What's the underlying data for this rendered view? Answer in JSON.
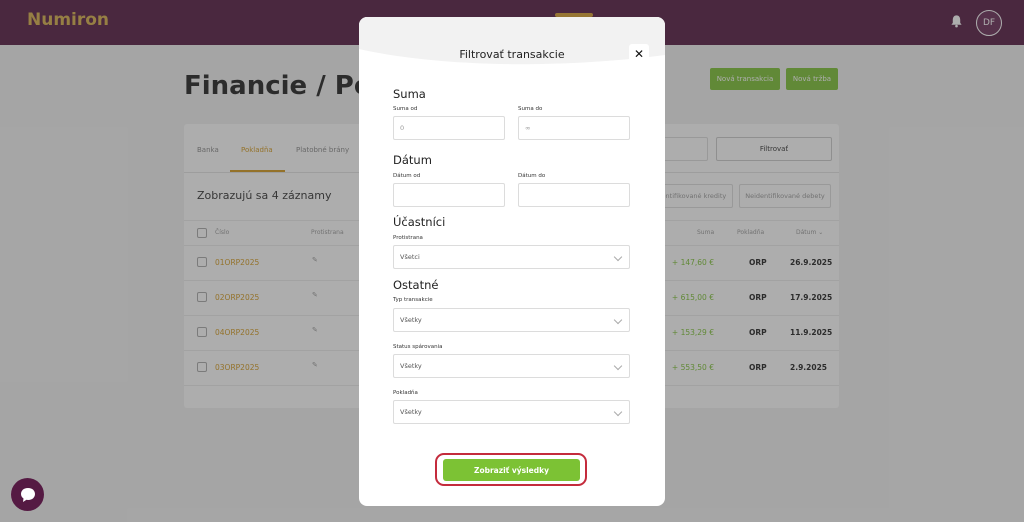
{
  "app": {
    "logo": "Numiron",
    "user_initials": "DF"
  },
  "page": {
    "title": "Financie / Pok",
    "new_transaction_label": "Nová transakcia",
    "new_other_label": "Nová tržba"
  },
  "tabs": [
    {
      "label": "Banka",
      "active": false
    },
    {
      "label": "Pokladňa",
      "active": true
    },
    {
      "label": "Platobné brány",
      "active": false
    }
  ],
  "toolbar": {
    "filter_label": "Filtrovať",
    "count_text": "Zobrazujú sa 4 záznamy",
    "chip_credits": "Neidentifikované kredity",
    "chip_debits": "Neidentifikované debety"
  },
  "table": {
    "headers": {
      "number": "Číslo",
      "counterparty": "Protistrana",
      "amount": "Suma",
      "cashbox": "Pokladňa",
      "date": "Dátum"
    },
    "rows": [
      {
        "number": "01ORP2025",
        "amount": "+ 147,60 €",
        "cashbox": "ORP",
        "date": "26.9.2025"
      },
      {
        "number": "02ORP2025",
        "amount": "+ 615,00 €",
        "cashbox": "ORP",
        "date": "17.9.2025"
      },
      {
        "number": "04ORP2025",
        "amount": "+ 153,29 €",
        "cashbox": "ORP",
        "date": "11.9.2025"
      },
      {
        "number": "03ORP2025",
        "amount": "+ 553,50 €",
        "cashbox": "ORP",
        "date": "2.9.2025"
      }
    ]
  },
  "modal": {
    "title": "Filtrovať transakcie",
    "close_glyph": "✕",
    "sections": {
      "amount": {
        "title": "Suma",
        "from_label": "Suma od",
        "from_value": "0",
        "to_label": "Suma do",
        "to_value": "∞"
      },
      "date": {
        "title": "Dátum",
        "from_label": "Dátum od",
        "to_label": "Dátum do"
      },
      "participants": {
        "title": "Účastníci",
        "counterparty_label": "Protistrana",
        "counterparty_value": "Všetci"
      },
      "other": {
        "title": "Ostatné",
        "type_label": "Typ transakcie",
        "type_value": "Všetky",
        "status_label": "Status spárovania",
        "status_value": "Všetky",
        "cashbox_label": "Pokladňa",
        "cashbox_value": "Všetky"
      }
    },
    "submit_label": "Zobraziť výsledky"
  },
  "colors": {
    "brand": "#551a43",
    "accent": "#d49a1e",
    "success": "#7cc234",
    "highlight": "#c42b3c"
  }
}
